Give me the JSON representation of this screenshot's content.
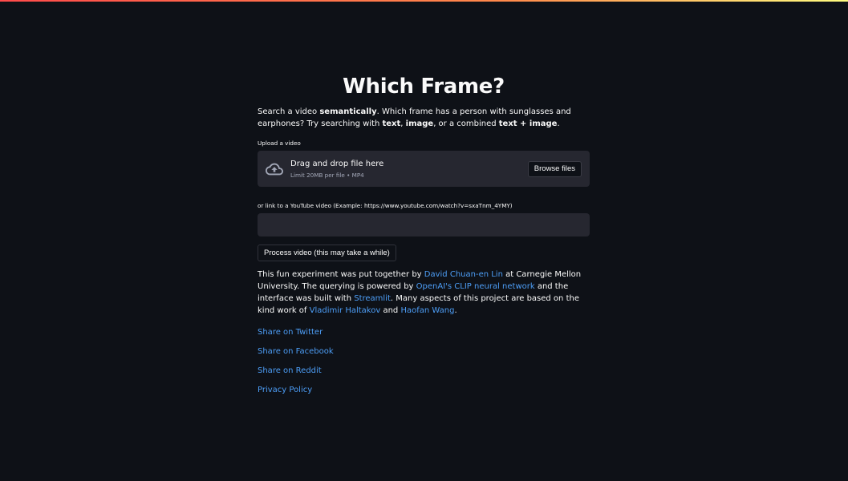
{
  "title": "Which Frame?",
  "intro": {
    "p1": "Search a video ",
    "b1": "semantically",
    "p2": ". Which frame has a person with sunglasses and earphones? Try searching with ",
    "b2": "text",
    "p3": ", ",
    "b3": "image",
    "p4": ", or a combined ",
    "b4": "text + image",
    "p5": "."
  },
  "upload": {
    "label": "Upload a video",
    "drop_text": "Drag and drop file here",
    "limit_text": "Limit 20MB per file • MP4",
    "browse_label": "Browse files",
    "icon": "cloud-upload-icon"
  },
  "youtube": {
    "label": "or link to a YouTube video (Example: https://www.youtube.com/watch?v=sxaTnm_4YMY)",
    "value": ""
  },
  "process_button": "Process video (this may take a while)",
  "about": {
    "t1": "This fun experiment was put together by ",
    "l1": "David Chuan-en Lin",
    "t2": " at Carnegie Mellon University. The querying is powered by ",
    "l2": "OpenAI's CLIP neural network",
    "t3": " and the interface was built with ",
    "l3": "Streamlit",
    "t4": ". Many aspects of this project are based on the kind work of ",
    "l4": "Vladimir Haltakov",
    "t5": " and ",
    "l5": "Haofan Wang",
    "t6": "."
  },
  "links": {
    "twitter": "Share on Twitter",
    "facebook": "Share on Facebook",
    "reddit": "Share on Reddit",
    "privacy": "Privacy Policy"
  },
  "colors": {
    "background": "#0e1117",
    "panel": "#262730",
    "link": "#4d9ef7",
    "text": "#fafafa"
  }
}
